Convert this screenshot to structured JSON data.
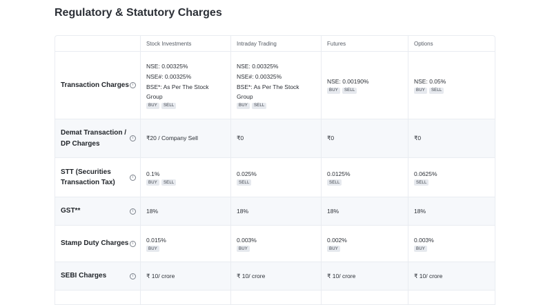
{
  "title": "Regulatory & Statutory Charges",
  "columns": [
    "Stock Investments",
    "Intraday Trading",
    "Futures",
    "Options"
  ],
  "info_glyph": "i",
  "rows": [
    {
      "label": "Transaction Charges",
      "cells": [
        {
          "lines": [
            "NSE: 0.00325%",
            "NSE#: 0.00325%",
            "BSE*: As Per The Stock Group"
          ],
          "tags": [
            "BUY",
            "SELL"
          ]
        },
        {
          "lines": [
            "NSE: 0.00325%",
            "NSE#: 0.00325%",
            "BSE*: As Per The Stock Group"
          ],
          "tags": [
            "BUY",
            "SELL"
          ]
        },
        {
          "lines": [
            "NSE: 0.00190%"
          ],
          "tags": [
            "BUY",
            "SELL"
          ]
        },
        {
          "lines": [
            "NSE: 0.05%"
          ],
          "tags": [
            "BUY",
            "SELL"
          ]
        }
      ]
    },
    {
      "label": "Demat Transaction / DP Charges",
      "cells": [
        {
          "lines": [
            "₹20 / Company Sell"
          ],
          "tags": []
        },
        {
          "lines": [
            "₹0"
          ],
          "tags": []
        },
        {
          "lines": [
            "₹0"
          ],
          "tags": []
        },
        {
          "lines": [
            "₹0"
          ],
          "tags": []
        }
      ]
    },
    {
      "label": "STT (Securities Transaction Tax)",
      "cells": [
        {
          "lines": [
            "0.1%"
          ],
          "tags": [
            "BUY",
            "SELL"
          ]
        },
        {
          "lines": [
            "0.025%"
          ],
          "tags": [
            "SELL"
          ]
        },
        {
          "lines": [
            "0.0125%"
          ],
          "tags": [
            "SELL"
          ]
        },
        {
          "lines": [
            "0.0625%"
          ],
          "tags": [
            "SELL"
          ]
        }
      ]
    },
    {
      "label": "GST**",
      "cells": [
        {
          "lines": [
            "18%"
          ],
          "tags": []
        },
        {
          "lines": [
            "18%"
          ],
          "tags": []
        },
        {
          "lines": [
            "18%"
          ],
          "tags": []
        },
        {
          "lines": [
            "18%"
          ],
          "tags": []
        }
      ]
    },
    {
      "label": "Stamp Duty Charges",
      "cells": [
        {
          "lines": [
            "0.015%"
          ],
          "tags": [
            "BUY"
          ]
        },
        {
          "lines": [
            "0.003%"
          ],
          "tags": [
            "BUY"
          ]
        },
        {
          "lines": [
            "0.002%"
          ],
          "tags": [
            "BUY"
          ]
        },
        {
          "lines": [
            "0.003%"
          ],
          "tags": [
            "BUY"
          ]
        }
      ]
    },
    {
      "label": "SEBI Charges",
      "cells": [
        {
          "lines": [
            "₹ 10/ crore"
          ],
          "tags": []
        },
        {
          "lines": [
            "₹ 10/ crore"
          ],
          "tags": []
        },
        {
          "lines": [
            "₹ 10/ crore"
          ],
          "tags": []
        },
        {
          "lines": [
            "₹ 10/ crore"
          ],
          "tags": []
        }
      ]
    }
  ]
}
